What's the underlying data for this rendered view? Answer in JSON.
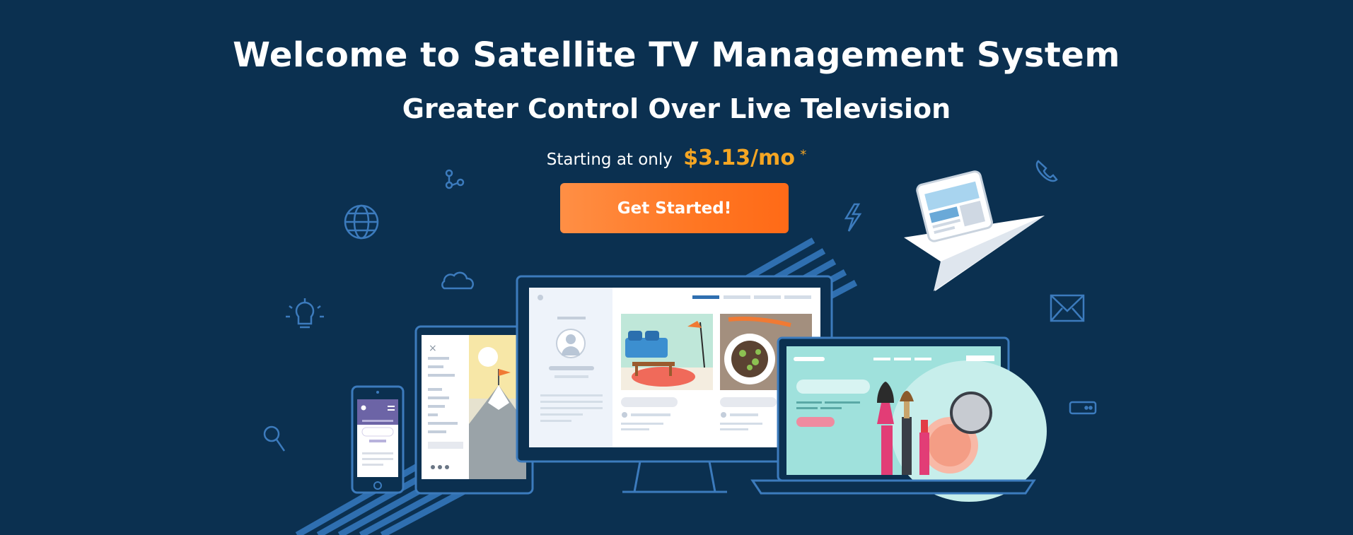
{
  "hero": {
    "title": "Welcome to Satellite TV Management System",
    "subtitle": "Greater Control Over Live Television",
    "price_prefix": "Starting at only",
    "price": "$3.13/mo",
    "price_footnote": "*",
    "cta_label": "Get Started!"
  },
  "colors": {
    "background": "#0b3050",
    "accent_price": "#f5a623",
    "cta_start": "#ff8f45",
    "cta_end": "#ff6a17",
    "line_blue": "#2f6fb0"
  },
  "icons": [
    "share-icon",
    "globe-icon",
    "cloud-icon",
    "lightbulb-icon",
    "magnifier-icon",
    "lightning-icon",
    "phone-icon",
    "mail-icon",
    "battery-icon",
    "paper-plane-icon"
  ]
}
